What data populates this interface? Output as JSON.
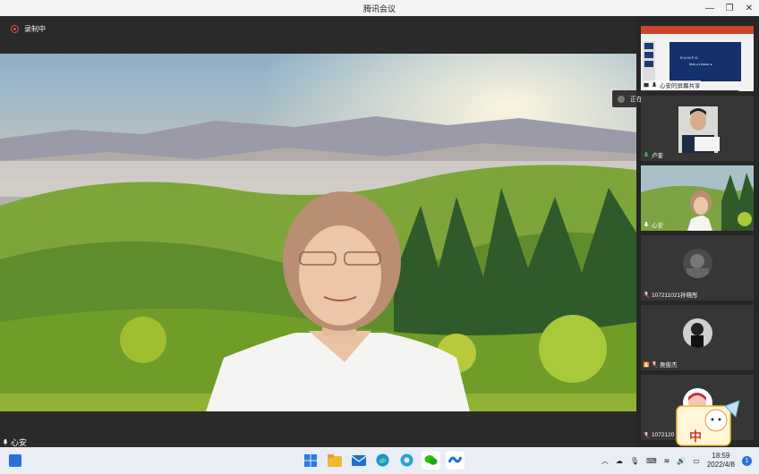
{
  "window": {
    "title": "腾讯会议",
    "minimize": "—",
    "restore": "❐",
    "close": "✕"
  },
  "recording": {
    "label": "录制中"
  },
  "main": {
    "speaker_name": "心安"
  },
  "speaking": {
    "label": "正在讲话: 卢奎;"
  },
  "participants": [
    {
      "name": "心安的屏幕共享"
    },
    {
      "name": "卢奎"
    },
    {
      "name": "心安"
    },
    {
      "name": "107211021孙晓彤"
    },
    {
      "name": "吴俊杰"
    },
    {
      "name": "1072120"
    }
  ],
  "shared_slide": {
    "line1": "R·A·M·F·D",
    "line2": "Now ● Lesson ●"
  },
  "sticker": {
    "text": "中"
  },
  "taskbar": {
    "time": "18:59",
    "date": "2022/4/8",
    "notifications": "1",
    "icons": [
      "start-icon",
      "file-explorer-icon",
      "mail-icon",
      "edge-icon",
      "edge-alt-icon",
      "wechat-icon",
      "tencent-meeting-icon"
    ]
  },
  "colors": {
    "accent": "#2a6fdb",
    "record": "#d9534f",
    "mic_green": "#39b54a"
  }
}
